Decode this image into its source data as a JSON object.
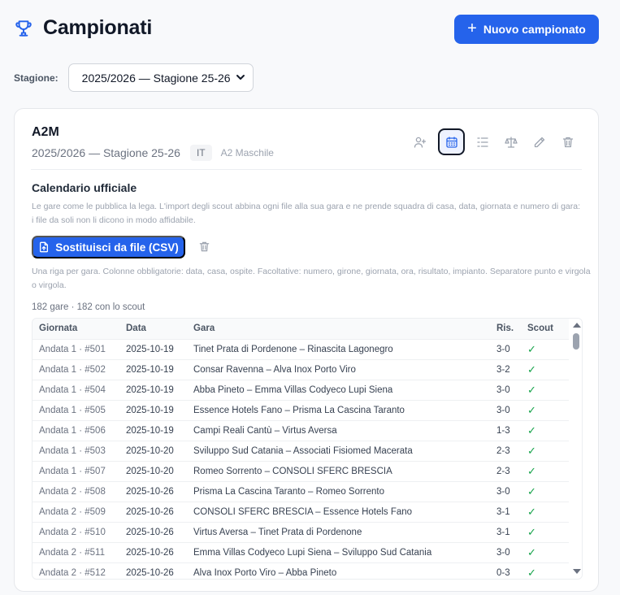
{
  "header": {
    "title": "Campionati",
    "new_button": "Nuovo campionato",
    "trophy_icon": "trophy-icon",
    "accent": "#2563eb"
  },
  "season": {
    "label": "Stagione:",
    "selected": "2025/2026 — Stagione 25-26"
  },
  "championship": {
    "name": "A2M",
    "season": "2025/2026 — Stagione 25-26",
    "country": "IT",
    "description": "A2 Maschile",
    "actions": [
      "add-user-icon",
      "calendar-icon",
      "list-icon",
      "scale-icon",
      "pencil-icon",
      "trash-icon"
    ]
  },
  "calendar": {
    "title": "Calendario ufficiale",
    "description": "Le gare come le pubblica la lega. L'import degli scout abbina ogni file alla sua gara e ne prende squadra di casa, data, giornata e numero di gara: i file da soli non li dicono in modo affidabile.",
    "replace_button": "Sostituisci da file (CSV)",
    "csv_help": "Una riga per gara. Colonne obbligatorie: data, casa, ospite. Facoltative: numero, girone, giornata, ora, risultato, impianto. Separatore punto e virgola o virgola.",
    "count": "182 gare · 182 con lo scout"
  },
  "table": {
    "headers": [
      "Giornata",
      "Data",
      "Gara",
      "Ris.",
      "Scout"
    ],
    "rows": [
      {
        "giornata": "Andata 1 · #501",
        "data": "2025-10-19",
        "gara": "Tinet Prata di Pordenone – Rinascita Lagonegro",
        "ris": "3-0",
        "scout": "✓"
      },
      {
        "giornata": "Andata 1 · #502",
        "data": "2025-10-19",
        "gara": "Consar Ravenna – Alva Inox Porto Viro",
        "ris": "3-2",
        "scout": "✓"
      },
      {
        "giornata": "Andata 1 · #504",
        "data": "2025-10-19",
        "gara": "Abba Pineto – Emma Villas Codyeco Lupi Siena",
        "ris": "3-0",
        "scout": "✓"
      },
      {
        "giornata": "Andata 1 · #505",
        "data": "2025-10-19",
        "gara": "Essence Hotels Fano – Prisma La Cascina Taranto",
        "ris": "3-0",
        "scout": "✓"
      },
      {
        "giornata": "Andata 1 · #506",
        "data": "2025-10-19",
        "gara": "Campi Reali Cantù – Virtus Aversa",
        "ris": "1-3",
        "scout": "✓"
      },
      {
        "giornata": "Andata 1 · #503",
        "data": "2025-10-20",
        "gara": "Sviluppo Sud Catania – Associati Fisiomed Macerata",
        "ris": "2-3",
        "scout": "✓"
      },
      {
        "giornata": "Andata 1 · #507",
        "data": "2025-10-20",
        "gara": "Romeo Sorrento – CONSOLI SFERC BRESCIA",
        "ris": "2-3",
        "scout": "✓"
      },
      {
        "giornata": "Andata 2 · #508",
        "data": "2025-10-26",
        "gara": "Prisma La Cascina Taranto – Romeo Sorrento",
        "ris": "3-0",
        "scout": "✓"
      },
      {
        "giornata": "Andata 2 · #509",
        "data": "2025-10-26",
        "gara": "CONSOLI SFERC BRESCIA – Essence Hotels Fano",
        "ris": "3-1",
        "scout": "✓"
      },
      {
        "giornata": "Andata 2 · #510",
        "data": "2025-10-26",
        "gara": "Virtus Aversa – Tinet Prata di Pordenone",
        "ris": "3-1",
        "scout": "✓"
      },
      {
        "giornata": "Andata 2 · #511",
        "data": "2025-10-26",
        "gara": "Emma Villas Codyeco Lupi Siena – Sviluppo Sud Catania",
        "ris": "3-0",
        "scout": "✓"
      },
      {
        "giornata": "Andata 2 · #512",
        "data": "2025-10-26",
        "gara": "Alva Inox Porto Viro – Abba Pineto",
        "ris": "0-3",
        "scout": "✓"
      }
    ]
  }
}
